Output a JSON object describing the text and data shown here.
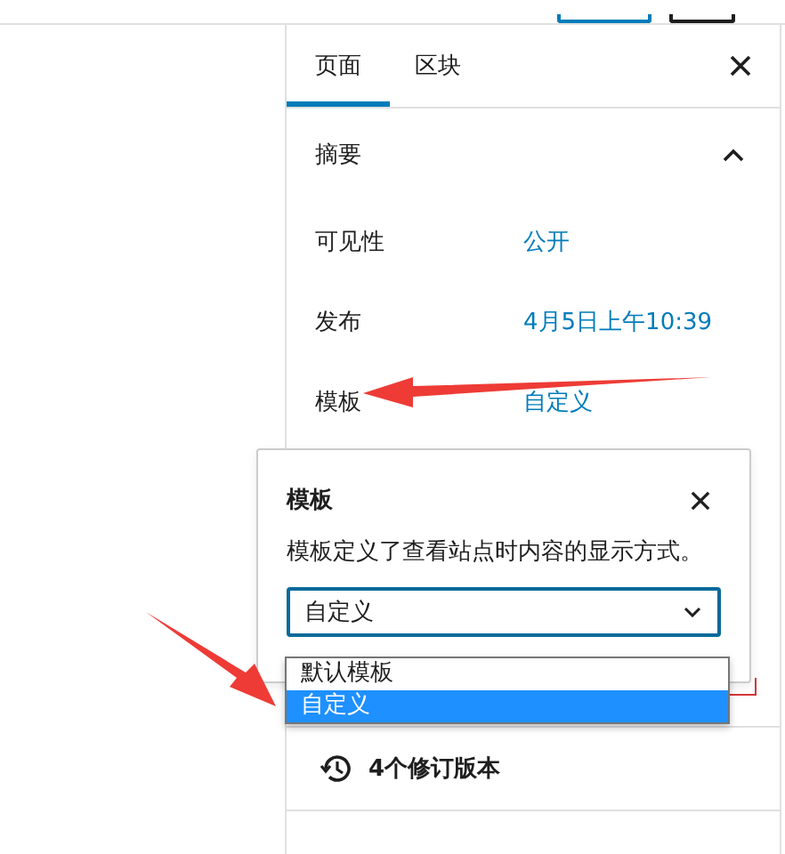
{
  "sidebar": {
    "tabs": [
      {
        "label": "页面",
        "selected": true
      },
      {
        "label": "区块",
        "selected": false
      }
    ],
    "summary": {
      "title": "摘要",
      "expanded": true,
      "rows": [
        {
          "label": "可见性",
          "value": "公开"
        },
        {
          "label": "发布",
          "value": "4月5日上午10:39"
        },
        {
          "label": "模板",
          "value": "自定义"
        }
      ]
    },
    "revisions": {
      "label": "4个修订版本"
    }
  },
  "popover": {
    "title": "模板",
    "description": "模板定义了查看站点时内容的显示方式。",
    "select": {
      "value": "自定义",
      "open": true,
      "options": [
        {
          "label": "默认模板",
          "selected": false
        },
        {
          "label": "自定义",
          "selected": true
        }
      ]
    }
  }
}
